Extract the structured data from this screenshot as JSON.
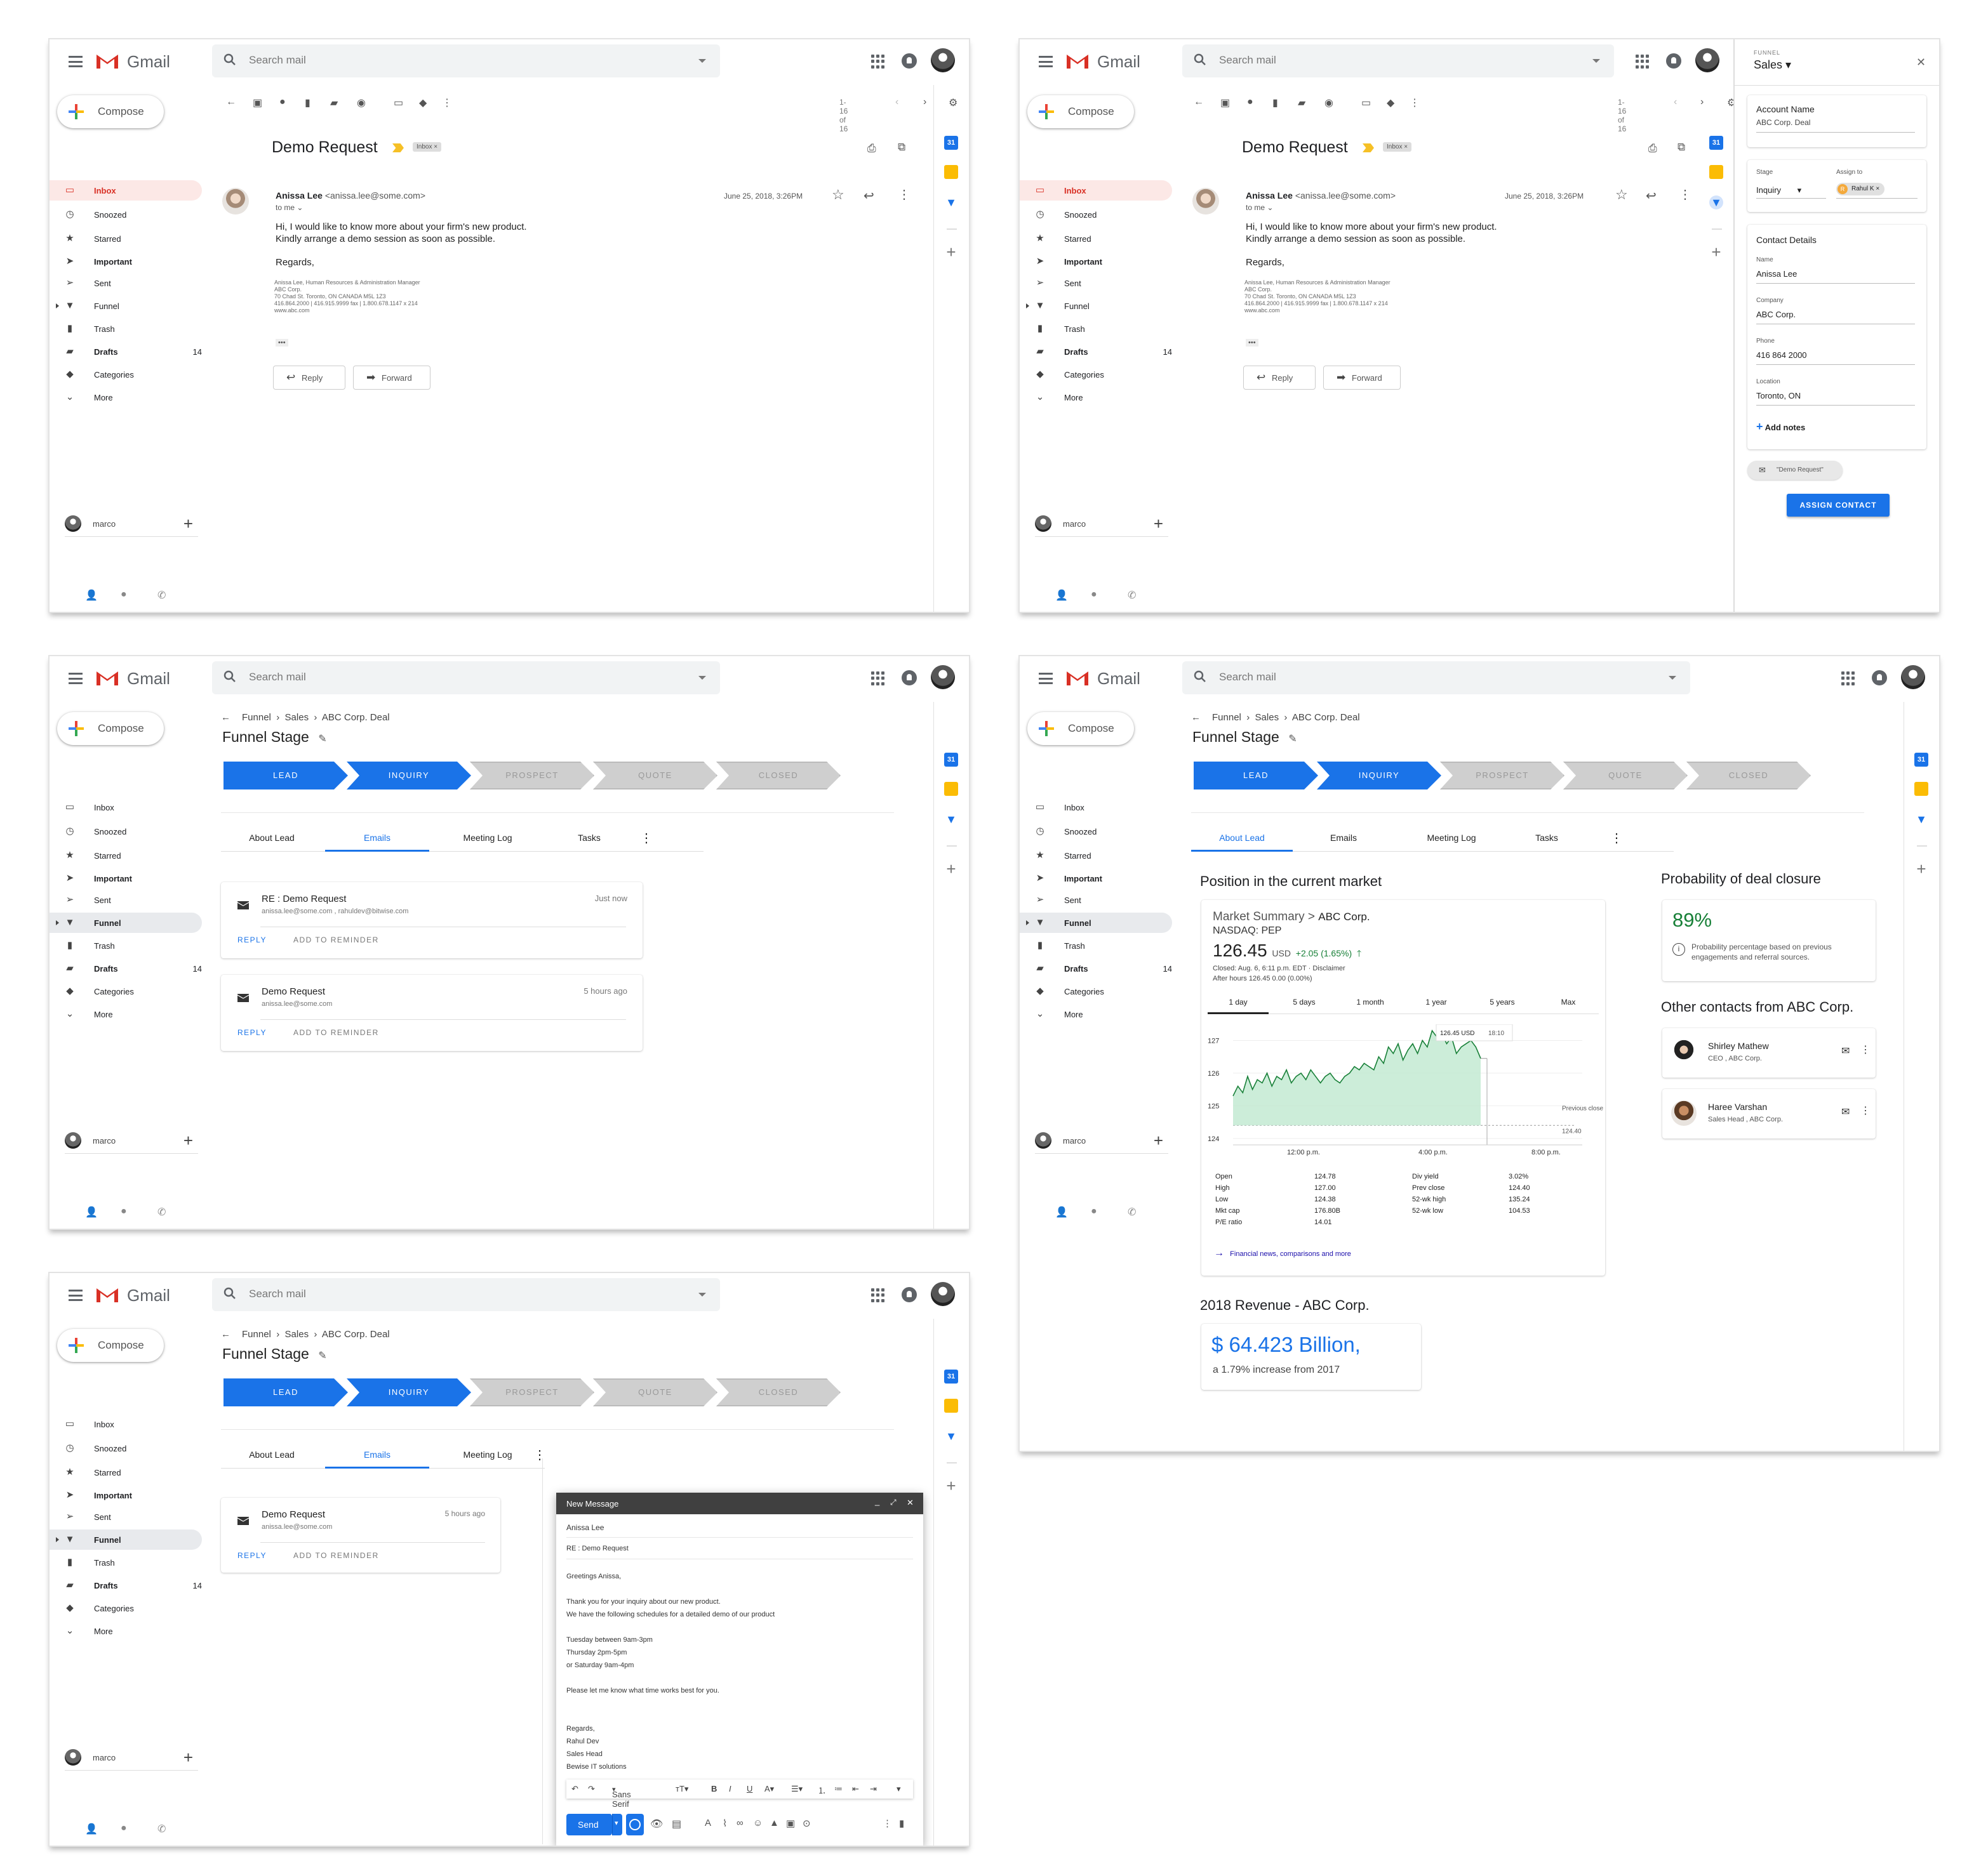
{
  "common": {
    "app_name": "Gmail",
    "search_placeholder": "Search mail",
    "compose": "Compose",
    "user": "marco",
    "nav": [
      {
        "label": "Inbox",
        "icon": "inbox-icon"
      },
      {
        "label": "Snoozed",
        "icon": "clock-icon"
      },
      {
        "label": "Starred",
        "icon": "star-icon"
      },
      {
        "label": "Important",
        "icon": "important-icon"
      },
      {
        "label": "Sent",
        "icon": "send-icon"
      },
      {
        "label": "Funnel",
        "icon": "funnel-icon"
      },
      {
        "label": "Trash",
        "icon": "trash-icon"
      },
      {
        "label": "Drafts",
        "icon": "draft-icon",
        "count": "14"
      },
      {
        "label": "Categories",
        "icon": "label-icon"
      },
      {
        "label": "More",
        "icon": "chevron-down-icon"
      }
    ]
  },
  "email_view": {
    "pagination": "1-16 of 16",
    "subject": "Demo Request",
    "label_chip": "Inbox ×",
    "sender_name": "Anissa Lee",
    "sender_email": "<anissa.lee@some.com>",
    "to": "to me",
    "date": "June 25, 2018, 3:26PM",
    "body": [
      "Hi, I would like to know more about your firm's new product.",
      "Kindly arrange a demo session as soon as possible."
    ],
    "regards": "Regards,",
    "signature": [
      "Anissa Lee, Human Resources & Administration Manager",
      "ABC Corp.",
      "70 Chad St. Toronto, ON CANADA M5L 1Z3",
      "416.864.2000  |  416.915.9999 fax  |  1.800.678.1147 x 214",
      "www.abc.com"
    ],
    "ellipsis": "•••",
    "reply": "Reply",
    "forward": "Forward"
  },
  "side_panel": {
    "funnel_label": "FUNNEL",
    "funnel_value": "Sales",
    "account_label": "Account Name",
    "account_value": "ABC Corp. Deal",
    "stage_label": "Stage",
    "stage_value": "Inquiry",
    "assign_label": "Assign to",
    "assignee": "Rahul K",
    "assignee_initial": "R",
    "contact_title": "Contact Details",
    "fields": [
      {
        "label": "Name",
        "value": "Anissa Lee"
      },
      {
        "label": "Company",
        "value": "ABC Corp."
      },
      {
        "label": "Phone",
        "value": "416 864 2000"
      },
      {
        "label": "Location",
        "value": "Toronto, ON"
      }
    ],
    "add_notes": "Add notes",
    "email_chip": "\"Demo Request\"",
    "assign_button": "ASSIGN CONTACT"
  },
  "funnel_view": {
    "breadcrumb": [
      "Funnel",
      "Sales",
      "ABC Corp. Deal"
    ],
    "title": "Funnel Stage",
    "stages": [
      "LEAD",
      "INQUIRY",
      "PROSPECT",
      "QUOTE",
      "CLOSED"
    ],
    "active_stage_count": 2,
    "tabs": [
      "About Lead",
      "Emails",
      "Meeting Log",
      "Tasks"
    ],
    "emails": [
      {
        "subject": "RE : Demo Request",
        "addr": "anissa.lee@some.com , rahuldev@bitwise.com",
        "time": "Just now"
      },
      {
        "subject": "Demo Request",
        "addr": "anissa.lee@some.com",
        "time": "5 hours ago"
      }
    ],
    "reply_action": "REPLY",
    "reminder_action": "ADD TO REMINDER"
  },
  "about_lead": {
    "market_title": "Position in the current market",
    "market_summary": "Market Summary >",
    "company": "ABC Corp.",
    "ticker": "NASDAQ: PEP",
    "price": "126.45",
    "currency": "USD",
    "change": "+2.05 (1.65%)",
    "closed_line": "Closed: Aug. 6, 6:11 p.m. EDT · Disclaimer",
    "after_hours": "After hours 126.45 0.00 (0.00%)",
    "ranges": [
      "1 day",
      "5 days",
      "1 month",
      "1 year",
      "5 years",
      "Max"
    ],
    "tooltip_value": "126.45 USD",
    "tooltip_time": "18:10",
    "prev_close_label": "Previous close",
    "prev_close_value": "124.40",
    "stats_left": [
      [
        "Open",
        "124.78"
      ],
      [
        "High",
        "127.00"
      ],
      [
        "Low",
        "124.38"
      ],
      [
        "Mkt cap",
        "176.80B"
      ],
      [
        "P/E ratio",
        "14.01"
      ]
    ],
    "stats_right": [
      [
        "Div yield",
        "3.02%"
      ],
      [
        "Prev close",
        "124.40"
      ],
      [
        "52-wk high",
        "135.24"
      ],
      [
        "52-wk low",
        "104.53"
      ]
    ],
    "news_link": "Financial news, comparisons and more",
    "revenue_title": "2018 Revenue - ABC Corp.",
    "revenue_value": "$ 64.423 Billion,",
    "revenue_sub": "a 1.79% increase from 2017",
    "prob_title": "Probability of deal closure",
    "prob_value": "89%",
    "prob_note": "Probability percentage based on previous engagements and referral sources.",
    "contacts_title": "Other contacts from ABC Corp.",
    "contacts": [
      {
        "name": "Shirley Mathew",
        "role": "CEO , ABC Corp."
      },
      {
        "name": "Haree Varshan",
        "role": "Sales Head , ABC Corp."
      }
    ]
  },
  "chart_data": {
    "type": "line",
    "title": "",
    "xlabel": "",
    "ylabel": "",
    "x_ticks": [
      "12:00 p.m.",
      "4:00 p.m.",
      "8:00 p.m."
    ],
    "y_ticks": [
      124,
      125,
      126,
      127
    ],
    "ylim": [
      123.9,
      127.3
    ],
    "baseline": 124.4,
    "grid": true,
    "series": [
      {
        "values": [
          125.3,
          125.6,
          125.4,
          125.9,
          125.5,
          125.8,
          125.7,
          126.0,
          125.6,
          125.9,
          125.8,
          126.1,
          125.7,
          125.9,
          126.0,
          125.8,
          126.1,
          125.9,
          125.7,
          125.9,
          126.0,
          125.8,
          125.7,
          125.9,
          126.0,
          126.2,
          126.1,
          126.3,
          126.2,
          126.1,
          126.5,
          126.3,
          126.8,
          126.6,
          126.9,
          126.4,
          126.7,
          126.9,
          126.6,
          127.0,
          126.8,
          127.3,
          127.1,
          127.2,
          126.9,
          127.1,
          126.6,
          126.8,
          126.9,
          127.0,
          126.8,
          126.45
        ]
      }
    ]
  },
  "compose": {
    "header": "New Message",
    "to": "Anissa Lee",
    "subject": "RE : Demo Request",
    "lines": [
      "Greetings Anissa,",
      "",
      "Thank you for your inquiry about our new product.",
      "We have the following schedules for a detailed demo of our product",
      "",
      "Tuesday between 9am-3pm",
      "Thursday 2pm-5pm",
      "or Saturday 9am-4pm",
      "",
      "Please let me know what time works best for you.",
      "",
      "",
      "Regards,",
      "Rahul Dev",
      "Sales Head",
      "Bewise IT solutions"
    ],
    "font": "Sans Serif",
    "send": "Send"
  }
}
